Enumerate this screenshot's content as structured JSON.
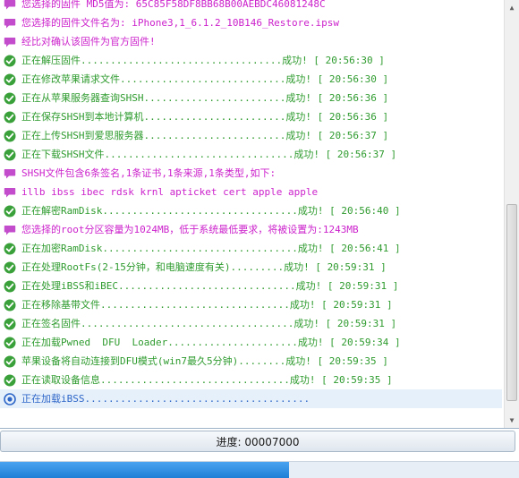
{
  "icons": {
    "success": {
      "name": "check-circle-icon",
      "color": "#3aa13a"
    },
    "info": {
      "name": "speech-bubble-icon",
      "color": "#c24ccb"
    },
    "running": {
      "name": "spinner-ring-icon",
      "color": "#2f67c8"
    }
  },
  "log": [
    {
      "icon": "info",
      "color": "magenta",
      "text": "您选择的固件 MD5值为: 65C85F58DF8BB68B00AEBDC46081248C"
    },
    {
      "icon": "info",
      "color": "magenta",
      "text": "您选择的固件文件名为: iPhone3,1_6.1.2_10B146_Restore.ipsw"
    },
    {
      "icon": "info",
      "color": "magenta",
      "text": "经比对确认该固件为官方固件!"
    },
    {
      "icon": "success",
      "color": "green",
      "text": "正在解压固件..................................成功! [ 20:56:30 ]"
    },
    {
      "icon": "success",
      "color": "green",
      "text": "正在修改苹果请求文件............................成功! [ 20:56:30 ]"
    },
    {
      "icon": "success",
      "color": "green",
      "text": "正在从苹果服务器查询SHSH........................成功! [ 20:56:36 ]"
    },
    {
      "icon": "success",
      "color": "green",
      "text": "正在保存SHSH到本地计算机........................成功! [ 20:56:36 ]"
    },
    {
      "icon": "success",
      "color": "green",
      "text": "正在上传SHSH到爱思服务器........................成功! [ 20:56:37 ]"
    },
    {
      "icon": "success",
      "color": "green",
      "text": "正在下载SHSH文件................................成功! [ 20:56:37 ]"
    },
    {
      "icon": "info",
      "color": "magenta",
      "text": "SHSH文件包含6条签名,1条证书,1条来源,1条类型,如下:"
    },
    {
      "icon": "info",
      "color": "magenta",
      "text": "illb ibss ibec rdsk krnl apticket cert apple apple"
    },
    {
      "icon": "success",
      "color": "green",
      "text": "正在解密RamDisk.................................成功! [ 20:56:40 ]"
    },
    {
      "icon": "info",
      "color": "magenta",
      "text": "您选择的root分区容量为1024MB，低于系统最低要求，将被设置为:1243MB"
    },
    {
      "icon": "success",
      "color": "green",
      "text": "正在加密RamDisk.................................成功! [ 20:56:41 ]"
    },
    {
      "icon": "success",
      "color": "green",
      "text": "正在处理RootFs(2-15分钟，和电脑速度有关).........成功! [ 20:59:31 ]"
    },
    {
      "icon": "success",
      "color": "green",
      "text": "正在处理iBSS和iBEC..............................成功! [ 20:59:31 ]"
    },
    {
      "icon": "success",
      "color": "green",
      "text": "正在移除基带文件................................成功! [ 20:59:31 ]"
    },
    {
      "icon": "success",
      "color": "green",
      "text": "正在签名固件....................................成功! [ 20:59:31 ]"
    },
    {
      "icon": "success",
      "color": "green",
      "text": "正在加载Pwned  DFU  Loader......................成功! [ 20:59:34 ]"
    },
    {
      "icon": "success",
      "color": "green",
      "text": "苹果设备将自动连接到DFU模式(win7最久5分钟)........成功! [ 20:59:35 ]"
    },
    {
      "icon": "success",
      "color": "green",
      "text": "正在读取设备信息................................成功! [ 20:59:35 ]"
    },
    {
      "icon": "running",
      "color": "blue",
      "text": "正在加载iBSS......................................",
      "current": true
    }
  ],
  "status": {
    "progress_text": "进度: 00007000"
  },
  "progress": {
    "fraction": 0.557
  },
  "scroll": {
    "position_fraction": 0.95
  },
  "colors": {
    "green": "#2e9b2e",
    "magenta": "#cc22cc",
    "blue": "#2f67c8",
    "progress": "#1f7fd6"
  }
}
